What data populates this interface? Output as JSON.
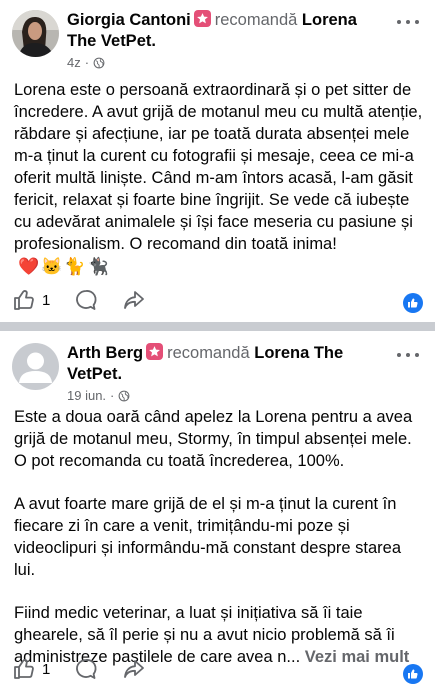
{
  "posts": [
    {
      "author": "Giorgia Cantoni",
      "action": "recomandă",
      "page_name": "Lorena The VetPet.",
      "time": "4z",
      "visibility_icon": "globe-icon",
      "paragraphs": [
        "Lorena este o persoană extraordinară și o pet sitter de încredere. A avut grijă de motanul meu cu multă atenție, răbdare și afecțiune, iar pe toată durata absenței mele m-a ținut la curent cu fotografii și mesaje, ceea ce mi-a oferit multă liniște. Când m-am întors acasă, l-am găsit fericit, relaxat și foarte bine îngrijit. Se vede că iubește cu adevărat animalele și își face meseria cu pasiune și profesionalism. O recomand din toată inima!"
      ],
      "emojis": "❤️🐱🐈🐈‍⬛",
      "like_count": "1",
      "see_more": ""
    },
    {
      "author": "Arth Berg",
      "action": "recomandă",
      "page_name": "Lorena The VetPet.",
      "time": "19 iun.",
      "visibility_icon": "globe-icon",
      "paragraphs": [
        "Este a doua oară când apelez la Lorena pentru a avea grijă de motanul meu, Stormy, în timpul absenței mele. O pot recomanda cu toată încrederea, 100%.",
        "A avut foarte mare grijă de el și m-a ținut la curent în fiecare zi în care a venit, trimițându-mi poze și videoclipuri și informându-mă constant despre starea lui.",
        "Fiind medic veterinar, a luat și inițiativa să îi taie ghearele, să îl perie și nu a avut nicio problemă să îi administreze pastilele de care avea n..."
      ],
      "emojis": "",
      "like_count": "1",
      "see_more": "Vezi mai mult"
    }
  ],
  "colors": {
    "background": "#c9ccd1",
    "card": "#ffffff",
    "text": "#050505",
    "secondary_text": "#65676b",
    "recommend_badge": "#e44f77",
    "like_blue": "#1877f2"
  }
}
